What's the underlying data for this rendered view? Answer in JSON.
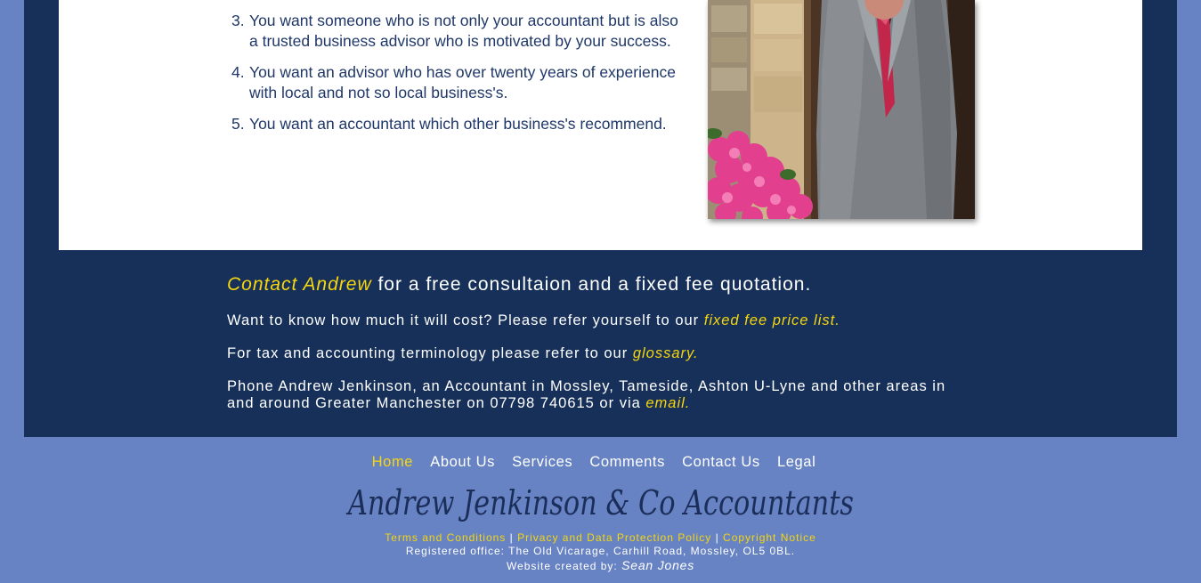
{
  "reasons": [
    {
      "num": "3.",
      "text": "You want someone who is not only your accountant but is also a trusted business advisor who is motivated by your success."
    },
    {
      "num": "4.",
      "text": "You want an advisor who has over twenty years of experience with local and not so local business's."
    },
    {
      "num": "5.",
      "text": "You want an accountant which other business's recommend."
    }
  ],
  "contact": {
    "heading_link": "Contact Andrew",
    "heading_rest": " for a free consultaion and a fixed fee quotation.",
    "price_text": "Want to know how much it will cost? Please refer yourself to our ",
    "price_link": "fixed fee price list.",
    "glossary_text": "For tax and accounting terminology please refer to our ",
    "glossary_link": "glossary.",
    "phone_text": "Phone Andrew Jenkinson, an Accountant in Mossley, Tameside, Ashton U-Lyne and other areas in and around Greater Manchester on 07798 740615 or via ",
    "email_link": "email."
  },
  "nav": {
    "items": [
      "Home",
      "About Us",
      "Services",
      "Comments",
      "Contact Us",
      "Legal"
    ],
    "active": "Home"
  },
  "logo_text": "Andrew Jenkinson & Co Accountants",
  "footer": {
    "terms": "Terms and Conditions",
    "privacy": "Privacy and Data Protection Policy",
    "copyright": "Copyright Notice",
    "separator": "|",
    "address": "Registered office: The Old Vicarage, Carhill Road, Mossley, OL5 0BL.",
    "credit_prefix": "Website created by: ",
    "credit_name": "Sean Jones"
  },
  "colors": {
    "page_bg": "#6783c3",
    "frame_bg": "#163059",
    "accent": "#f5d60f",
    "body_text": "#1f3768"
  }
}
